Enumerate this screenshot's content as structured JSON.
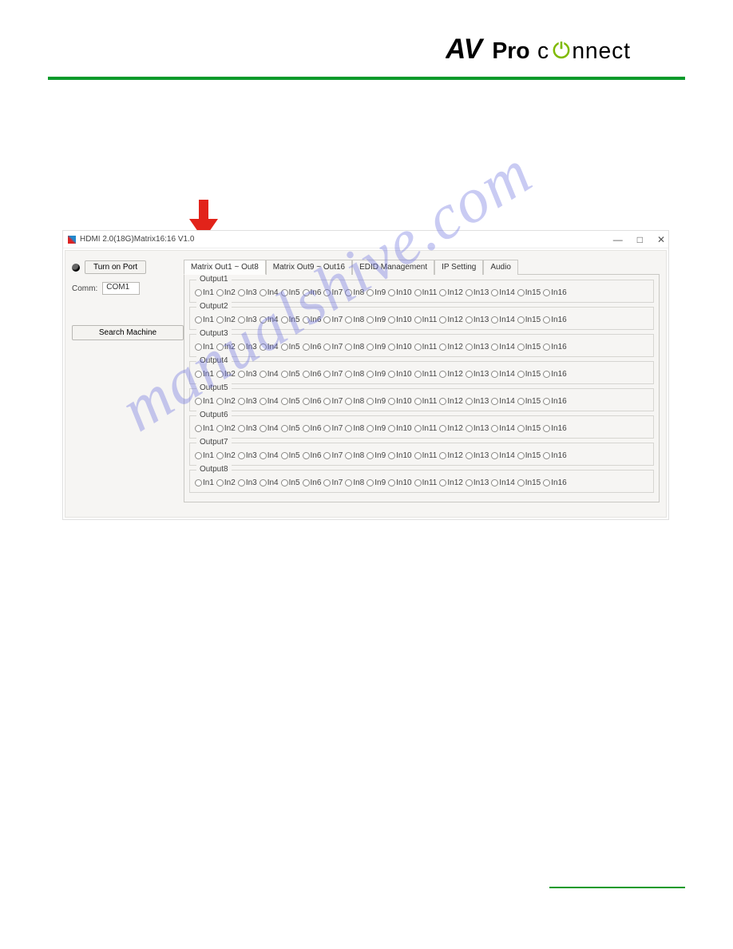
{
  "brand": {
    "av": "AV",
    "pro": "Pro",
    "connect_left": "c",
    "connect_power": "o",
    "connect_right": "nnect"
  },
  "watermark": "manualshive.com",
  "app": {
    "title": "HDMI 2.0(18G)Matrix16:16 V1.0",
    "win": {
      "min": "—",
      "max": "□",
      "close": "✕"
    },
    "side": {
      "turn_on": "Turn on Port",
      "comm_label": "Comm:",
      "comm_value": "COM1",
      "search": "Search Machine"
    },
    "tabs": [
      {
        "label": "Matrix Out1 ~ Out8",
        "active": true
      },
      {
        "label": "Matrix Out9 ~ Out16",
        "active": false
      },
      {
        "label": "EDID Management",
        "active": false
      },
      {
        "label": "IP Setting",
        "active": false
      },
      {
        "label": "Audio",
        "active": false
      }
    ],
    "outputs": [
      {
        "name": "Output1"
      },
      {
        "name": "Output2"
      },
      {
        "name": "Output3"
      },
      {
        "name": "Output4"
      },
      {
        "name": "Output5"
      },
      {
        "name": "Output6"
      },
      {
        "name": "Output7"
      },
      {
        "name": "Output8"
      }
    ],
    "inputs": [
      "In1",
      "In2",
      "In3",
      "In4",
      "In5",
      "In6",
      "In7",
      "In8",
      "In9",
      "In10",
      "In11",
      "In12",
      "In13",
      "In14",
      "In15",
      "In16"
    ]
  }
}
